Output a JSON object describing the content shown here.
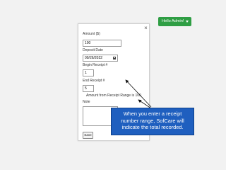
{
  "header": {
    "user_menu_label": "Hello Admin!",
    "user_menu_color": "#2f9e44"
  },
  "modal": {
    "close_label": "×",
    "amount_label": "Amount ($)",
    "amount_value": "100",
    "deposit_date_label": "Deposit Date",
    "deposit_date_value": "09/26/2022",
    "begin_receipt_label": "Begin Receipt #",
    "begin_receipt_value": "1",
    "end_receipt_label": "End Receipt #",
    "end_receipt_value": "5",
    "range_summary": "Amount from Receipt Range is 100",
    "note_label": "Note",
    "note_value": "",
    "save_label": "Save"
  },
  "callout": {
    "line1": "When you enter a receipt",
    "line2": "number range, SofCare will",
    "line3": "indicate the total recorded.",
    "color": "#1f5fbf"
  }
}
